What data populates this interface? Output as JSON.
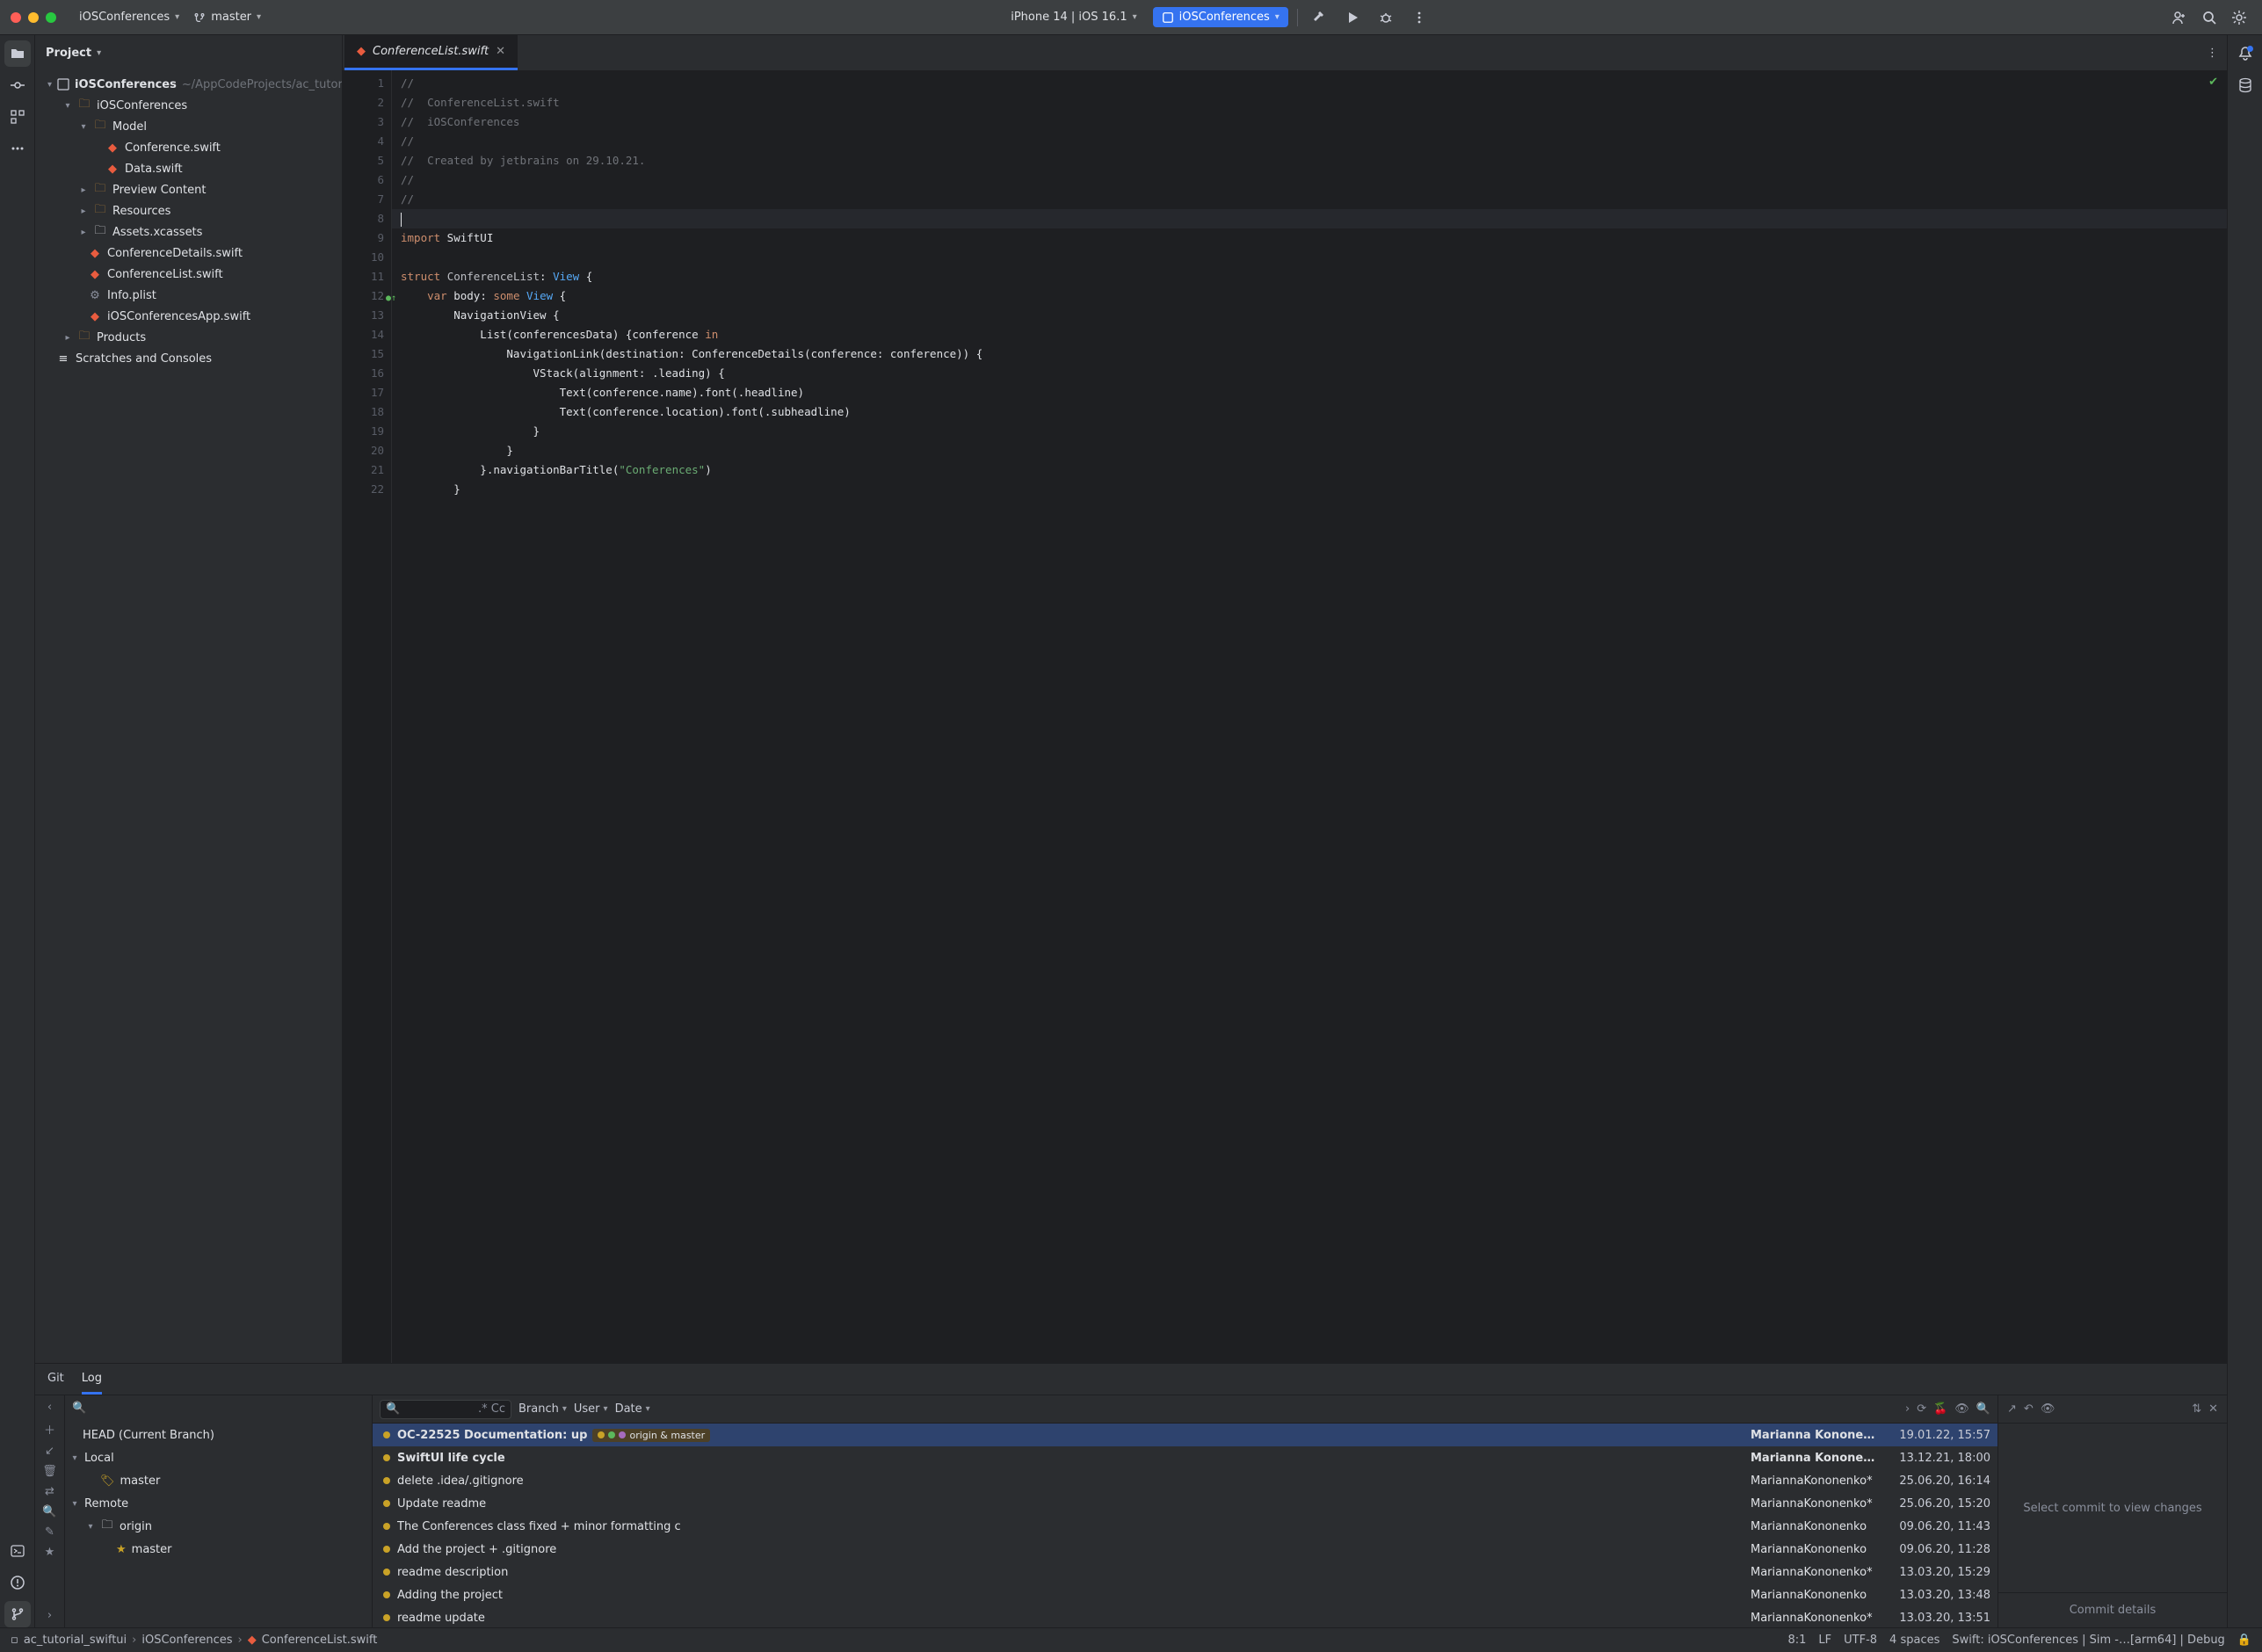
{
  "titlebar": {
    "project_name": "iOSConferences",
    "branch": "master",
    "device": "iPhone 14 | iOS 16.1",
    "run_config": "iOSConferences"
  },
  "project_panel": {
    "title": "Project",
    "root_name": "iOSConferences",
    "root_path": "~/AppCodeProjects/ac_tutorial",
    "scratches": "Scratches and Consoles",
    "products": "Products",
    "tree": {
      "app_group": "iOSConferences",
      "model_group": "Model",
      "conference_swift": "Conference.swift",
      "data_swift": "Data.swift",
      "preview_content": "Preview Content",
      "resources": "Resources",
      "assets": "Assets.xcassets",
      "conf_details": "ConferenceDetails.swift",
      "conf_list": "ConferenceList.swift",
      "info_plist": "Info.plist",
      "app_swift": "iOSConferencesApp.swift"
    }
  },
  "editor": {
    "tab_name": "ConferenceList.swift",
    "lines": [
      {
        "n": "1",
        "t": "//",
        "c": "cmt"
      },
      {
        "n": "2",
        "t": "//  ConferenceList.swift",
        "c": "cmt"
      },
      {
        "n": "3",
        "t": "//  iOSConferences",
        "c": "cmt"
      },
      {
        "n": "4",
        "t": "//",
        "c": "cmt"
      },
      {
        "n": "5",
        "t": "//  Created by jetbrains on 29.10.21.",
        "c": "cmt"
      },
      {
        "n": "6",
        "t": "//",
        "c": "cmt"
      },
      {
        "n": "7",
        "t": "//",
        "c": "cmt"
      },
      {
        "n": "8",
        "t": "",
        "c": "",
        "current": true
      },
      {
        "n": "9",
        "html": "<span class=\"kw\">import</span> SwiftUI"
      },
      {
        "n": "10",
        "t": ""
      },
      {
        "n": "11",
        "html": "<span class=\"kw\">struct</span> <span class=\"fn\">ConferenceList</span>: <span class=\"ty\">View</span> {"
      },
      {
        "n": "12",
        "html": "    <span class=\"kw\">var</span> body: <span class=\"kw\">some</span> <span class=\"ty\">View</span> {",
        "ov": "●↑"
      },
      {
        "n": "13",
        "html": "        NavigationView {"
      },
      {
        "n": "14",
        "html": "            List(conferencesData) {conference <span class=\"kw\">in</span>"
      },
      {
        "n": "15",
        "html": "                NavigationLink(destination: ConferenceDetails(conference: conference)) {"
      },
      {
        "n": "16",
        "html": "                    VStack(alignment: .leading) {"
      },
      {
        "n": "17",
        "html": "                        Text(conference.name).font(.headline)"
      },
      {
        "n": "18",
        "html": "                        Text(conference.location).font(.subheadline)"
      },
      {
        "n": "19",
        "html": "                    }"
      },
      {
        "n": "20",
        "html": "                }"
      },
      {
        "n": "21",
        "html": "            }.navigationBarTitle(<span class=\"st\">\"Conferences\"</span>)"
      },
      {
        "n": "22",
        "html": "        }"
      }
    ]
  },
  "vcs": {
    "git_tab": "Git",
    "log_tab": "Log",
    "head_label": "HEAD (Current Branch)",
    "local_label": "Local",
    "local_branch": "master",
    "remote_label": "Remote",
    "origin_label": "origin",
    "origin_branch": "master",
    "filters": {
      "branch": "Branch",
      "user": "User",
      "date": "Date",
      "regex": ".*",
      "case": "Cc"
    },
    "head_badge": "origin & master",
    "commits": [
      {
        "msg": "OC-22525 Documentation: up",
        "author": "Marianna Kononenko",
        "date": "19.01.22, 15:57",
        "head": true,
        "bold": true
      },
      {
        "msg": "SwiftUI life cycle",
        "author": "Marianna Kononenko",
        "date": "13.12.21, 18:00",
        "bold": true
      },
      {
        "msg": "delete .idea/.gitignore",
        "author": "MariannaKononenko*",
        "date": "25.06.20, 16:14"
      },
      {
        "msg": "Update readme",
        "author": "MariannaKononenko*",
        "date": "25.06.20, 15:20"
      },
      {
        "msg": "The Conferences class fixed + minor formatting c",
        "author": "MariannaKononenko",
        "date": "09.06.20, 11:43"
      },
      {
        "msg": "Add the project + .gitignore",
        "author": "MariannaKononenko",
        "date": "09.06.20, 11:28"
      },
      {
        "msg": "readme description",
        "author": "MariannaKononenko*",
        "date": "13.03.20, 15:29"
      },
      {
        "msg": "Adding the project",
        "author": "MariannaKononenko",
        "date": "13.03.20, 13:48"
      },
      {
        "msg": "readme update",
        "author": "MariannaKononenko*",
        "date": "13.03.20, 13:51"
      }
    ],
    "changes_placeholder": "Select commit to view changes",
    "details_placeholder": "Commit details"
  },
  "statusbar": {
    "crumb1": "ac_tutorial_swiftui",
    "crumb2": "iOSConferences",
    "crumb3": "ConferenceList.swift",
    "pos": "8:1",
    "le": "LF",
    "enc": "UTF-8",
    "indent": "4 spaces",
    "swift": "Swift: iOSConferences | Sim -…[arm64] | Debug"
  }
}
